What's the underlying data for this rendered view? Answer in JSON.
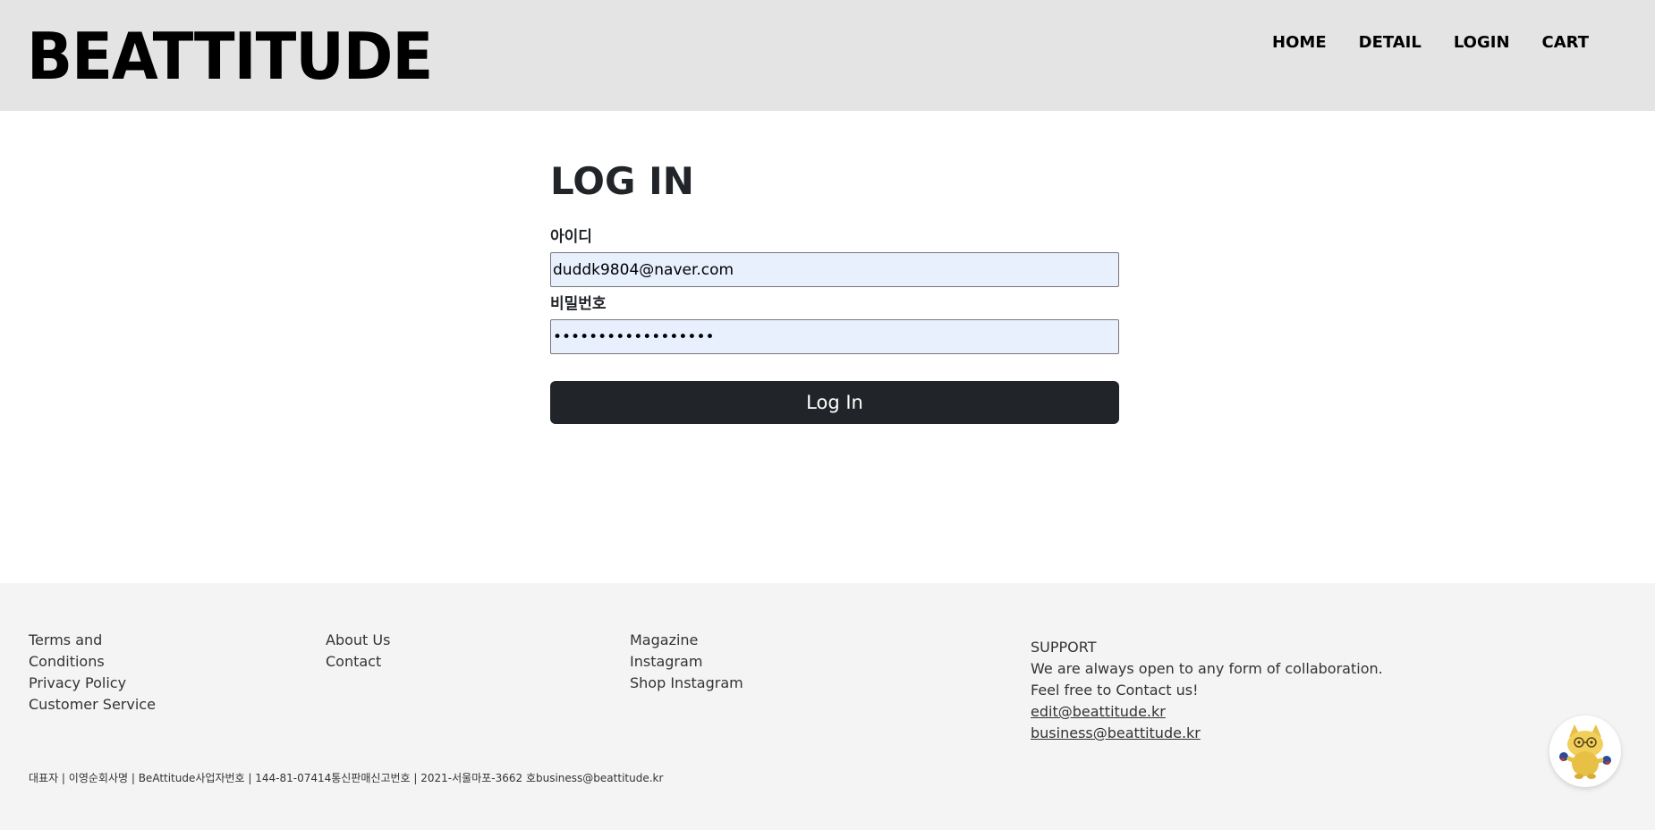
{
  "brand": {
    "logo": "BEATTITUDE"
  },
  "nav": {
    "items": [
      {
        "label": "HOME"
      },
      {
        "label": "DETAIL"
      },
      {
        "label": "LOGIN"
      },
      {
        "label": "CART"
      }
    ]
  },
  "login": {
    "title": "LOG IN",
    "id_label": "아이디",
    "id_value": "duddk9804@naver.com",
    "password_label": "비밀번호",
    "password_value": "••••••••••••••••••",
    "submit_label": "Log In"
  },
  "footer": {
    "col1": [
      "Terms and Conditions",
      "Privacy Policy",
      "Customer Service"
    ],
    "col2": [
      "About Us",
      "Contact"
    ],
    "col3": [
      "Magazine",
      "Instagram",
      "Shop Instagram"
    ],
    "support": {
      "heading": "SUPPORT",
      "line1": "We are always open to any form of collaboration.",
      "line2": "Feel free to Contact us!",
      "email1": "edit@beattitude.kr",
      "email2": "business@beattitude.kr"
    },
    "legal": "대표자 | 이영순회사명 | BeAttitude사업자번호 | 144-81-07414통신판매신고번호 | 2021-서울마포-3662 호business@beattitude.kr"
  },
  "colors": {
    "header_bg": "#e4e4e4",
    "footer_bg": "#f4f4f4",
    "button_bg": "#212529",
    "input_autofill_bg": "#e8f0fe"
  },
  "icons": {
    "chat_widget": "cat-mascot-icon"
  }
}
